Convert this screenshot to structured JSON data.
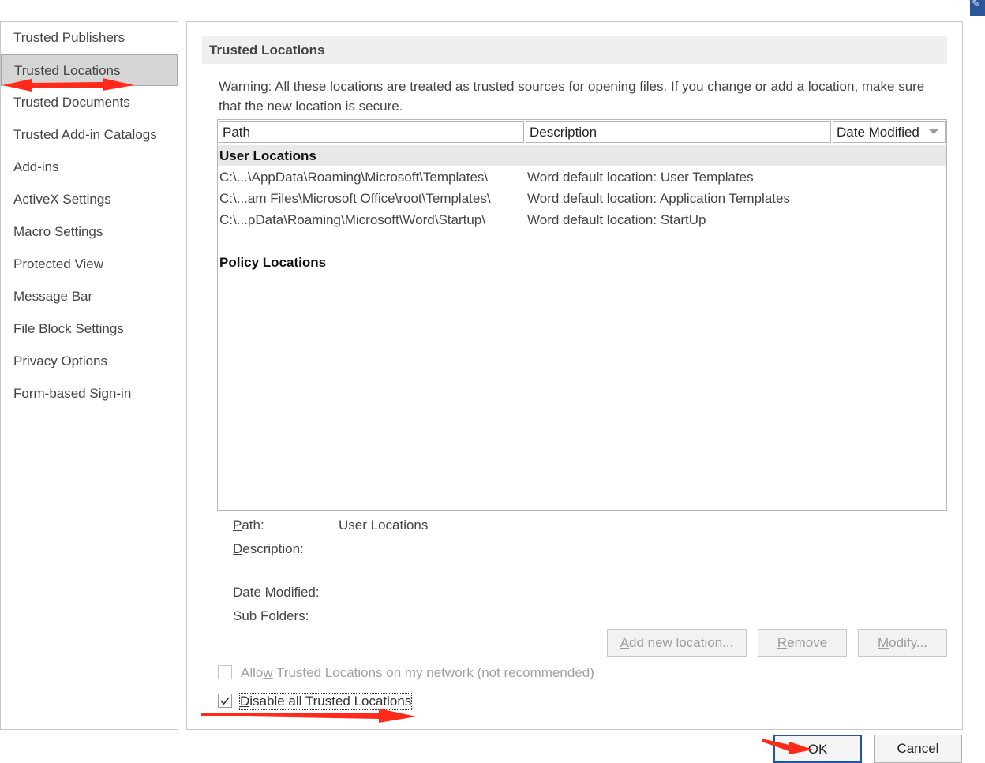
{
  "nav": {
    "items": [
      {
        "label": "Trusted Publishers",
        "selected": false
      },
      {
        "label": "Trusted Locations",
        "selected": true
      },
      {
        "label": "Trusted Documents",
        "selected": false
      },
      {
        "label": "Trusted Add-in Catalogs",
        "selected": false
      },
      {
        "label": "Add-ins",
        "selected": false
      },
      {
        "label": "ActiveX Settings",
        "selected": false
      },
      {
        "label": "Macro Settings",
        "selected": false
      },
      {
        "label": "Protected View",
        "selected": false
      },
      {
        "label": "Message Bar",
        "selected": false
      },
      {
        "label": "File Block Settings",
        "selected": false
      },
      {
        "label": "Privacy Options",
        "selected": false
      },
      {
        "label": "Form-based Sign-in",
        "selected": false
      }
    ]
  },
  "panel": {
    "title": "Trusted Locations",
    "warning": "Warning: All these locations are treated as trusted sources for opening files.  If you change or add a location, make sure that the new location is secure."
  },
  "list": {
    "columns": [
      "Path",
      "Description",
      "Date Modified"
    ],
    "groups": {
      "user": "User Locations",
      "policy": "Policy Locations"
    },
    "rows": [
      {
        "path": "C:\\...\\AppData\\Roaming\\Microsoft\\Templates\\",
        "description": "Word default location: User Templates"
      },
      {
        "path": "C:\\...am Files\\Microsoft Office\\root\\Templates\\",
        "description": "Word default location: Application Templates"
      },
      {
        "path": "C:\\...pData\\Roaming\\Microsoft\\Word\\Startup\\",
        "description": "Word default location: StartUp"
      }
    ]
  },
  "details": {
    "path_label_first": "P",
    "path_label_rest": "ath:",
    "path_value": "User Locations",
    "description_label_first": "D",
    "description_label_rest": "escription:",
    "date_modified_label": "Date Modified:",
    "sub_folders_label": "Sub Folders:"
  },
  "buttons": {
    "add_first": "A",
    "add_rest": "dd new location...",
    "remove_first": "R",
    "remove_rest": "emove",
    "modify_first": "M",
    "modify_rest": "odify...",
    "ok": "OK",
    "cancel": "Cancel"
  },
  "options": {
    "allow_network_a": "Allo",
    "allow_network_b": "w",
    "allow_network_c": " Trusted Locations on my network (not recommended)",
    "allow_network_checked": false,
    "disable_all_a": "D",
    "disable_all_b": "isable all Trusted Locations",
    "disable_all_checked": true
  },
  "colors": {
    "annotation_arrow": "#ff2a1a",
    "ok_border": "#1f55a8"
  }
}
